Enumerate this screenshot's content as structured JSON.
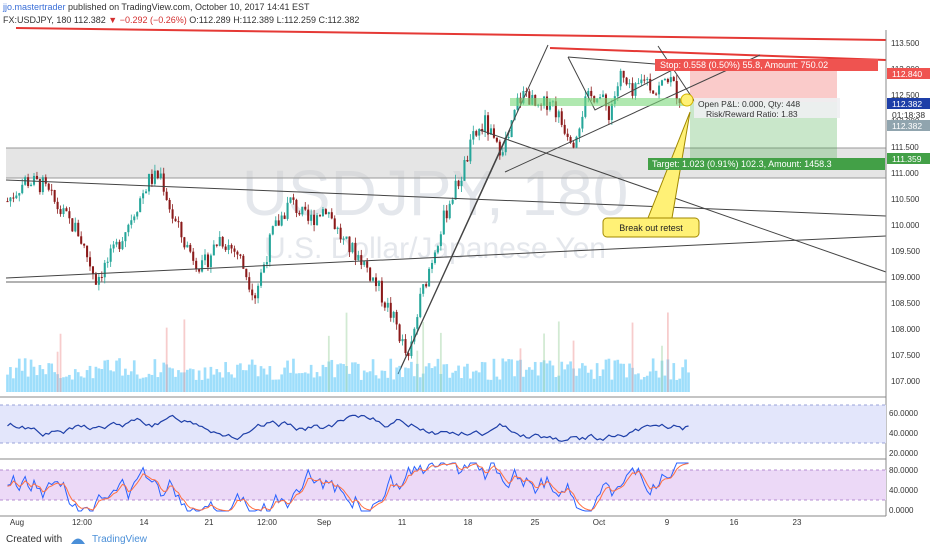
{
  "header": {
    "author": "jjo.mastertrader",
    "published_text": "published on TradingView.com, October 10, 2017 14:41 EST",
    "symbol_line": "FX:USDJPY, 180",
    "last": "112.382",
    "change": "−0.292 (−0.26%)",
    "open": "O:112.289",
    "high": "H:112.389",
    "low": "L:112.259",
    "close": "C:112.382"
  },
  "watermark": {
    "symbol": "USDJPY, 180",
    "name": "U.S. Dollar/Japanese Yen"
  },
  "annotations": {
    "stop": "Stop: 0.558 (0.50%) 55.8, Amount: 750.02",
    "pnl": "Open P&L: 0.000, Qty: 448",
    "rr": "Risk/Reward Ratio: 1.83",
    "target": "Target: 1.023 (0.91%) 102.3, Amount: 1458.3",
    "callout": "Break out retest",
    "countdown": "01:18:38"
  },
  "price_tags": {
    "stop": "112.840",
    "current": "112.382",
    "current2": "112.382",
    "target": "111.359"
  },
  "footer": {
    "created_with": "Created with",
    "brand": "TradingView"
  },
  "colors": {
    "up": "#26a69a",
    "down": "#8b1a1a",
    "trendline": "#e53935",
    "rsi": "#1e3fa8",
    "stoch_k": "#2962ff",
    "stoch_d": "#ff7043",
    "zone": "#b0b0b0",
    "profit": "#4caf50",
    "loss": "#ef5350"
  },
  "chart_data": {
    "type": "candlestick",
    "x_ticks": [
      "Aug",
      "12:00",
      "14",
      "21",
      "12:00",
      "Sep",
      "11",
      "18",
      "25",
      "Oct",
      "9",
      "16",
      "23"
    ],
    "price_ticks": [
      "113.500",
      "113.000",
      "112.500",
      "112.000",
      "111.500",
      "111.000",
      "110.500",
      "110.000",
      "109.500",
      "109.000",
      "108.500",
      "108.000",
      "107.500",
      "107.000"
    ],
    "ylim": [
      107.0,
      113.6
    ],
    "rsi_ticks": [
      "60.0000",
      "40.0000",
      "20.0000"
    ],
    "stoch_ticks": [
      "80.0000",
      "40.0000",
      "0.0000"
    ],
    "price_path": [
      [
        0,
        110.5
      ],
      [
        6,
        110.9
      ],
      [
        12,
        110.8
      ],
      [
        18,
        110.3
      ],
      [
        24,
        109.9
      ],
      [
        30,
        109.0
      ],
      [
        36,
        109.5
      ],
      [
        42,
        110.2
      ],
      [
        48,
        110.9
      ],
      [
        52,
        111.0
      ],
      [
        56,
        110.2
      ],
      [
        60,
        109.7
      ],
      [
        66,
        109.2
      ],
      [
        72,
        109.8
      ],
      [
        78,
        109.5
      ],
      [
        84,
        108.7
      ],
      [
        90,
        109.9
      ],
      [
        96,
        110.5
      ],
      [
        102,
        110.1
      ],
      [
        108,
        110.4
      ],
      [
        114,
        109.7
      ],
      [
        120,
        109.4
      ],
      [
        126,
        108.8
      ],
      [
        132,
        108.1
      ],
      [
        136,
        107.4
      ],
      [
        140,
        108.6
      ],
      [
        146,
        109.8
      ],
      [
        150,
        110.5
      ],
      [
        154,
        111.0
      ],
      [
        158,
        111.7
      ],
      [
        162,
        112.0
      ],
      [
        166,
        111.5
      ],
      [
        170,
        111.7
      ],
      [
        173,
        112.4
      ],
      [
        176,
        112.6
      ],
      [
        180,
        112.2
      ],
      [
        184,
        112.5
      ],
      [
        188,
        112.0
      ],
      [
        192,
        111.7
      ],
      [
        196,
        112.4
      ],
      [
        200,
        112.6
      ],
      [
        204,
        112.2
      ],
      [
        208,
        112.9
      ],
      [
        212,
        112.5
      ],
      [
        216,
        112.9
      ],
      [
        220,
        112.6
      ],
      [
        224,
        112.9
      ],
      [
        228,
        112.5
      ],
      [
        232,
        112.4
      ]
    ]
  }
}
